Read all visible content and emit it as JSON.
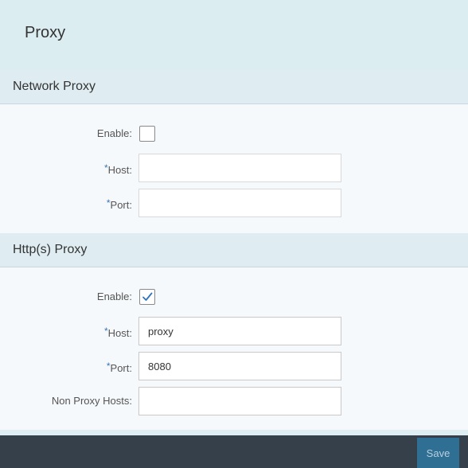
{
  "page": {
    "title": "Proxy"
  },
  "network_proxy": {
    "title": "Network Proxy",
    "enable_label": "Enable:",
    "enable_checked": false,
    "host_label": "Host:",
    "host_required_mark": "*",
    "host_value": "",
    "port_label": "Port:",
    "port_required_mark": "*",
    "port_value": ""
  },
  "http_proxy": {
    "title": "Http(s) Proxy",
    "enable_label": "Enable:",
    "enable_checked": true,
    "host_label": "Host:",
    "host_required_mark": "*",
    "host_value": "proxy",
    "port_label": "Port:",
    "port_required_mark": "*",
    "port_value": "8080",
    "non_proxy_hosts_label": "Non Proxy Hosts:",
    "non_proxy_hosts_value": ""
  },
  "footer": {
    "save_label": "Save"
  },
  "colors": {
    "header_bg": "#dcedf1",
    "body_bg": "#f6f9fb",
    "footer_bg": "#36404a",
    "save_button_bg": "#2f6f94",
    "required_mark": "#3a76b5",
    "checkmark": "#2f74c0"
  }
}
